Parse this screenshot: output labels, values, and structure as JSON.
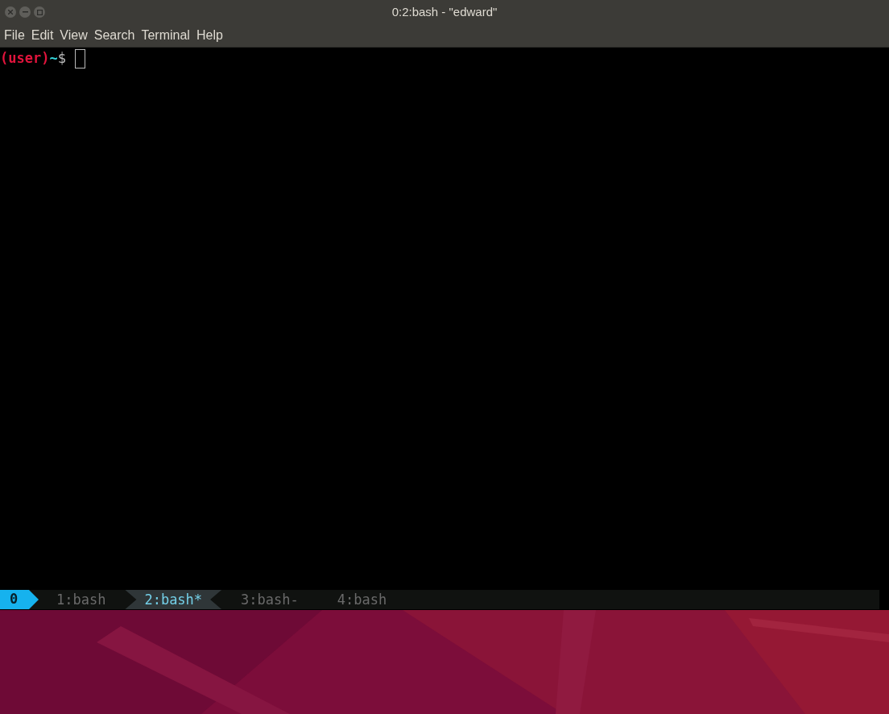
{
  "window": {
    "title": "0:2:bash - \"edward\""
  },
  "menu": [
    "File",
    "Edit",
    "View",
    "Search",
    "Terminal",
    "Help"
  ],
  "terminal": {
    "prompt_user": "(user)",
    "prompt_path": "~",
    "prompt_symbol": "$"
  },
  "tmux": {
    "session": "0",
    "windows": [
      {
        "label": "1:bash",
        "selected": false
      },
      {
        "label": "2:bash*",
        "selected": true
      },
      {
        "label": "3:bash-",
        "selected": false
      },
      {
        "label": "4:bash",
        "selected": false
      }
    ]
  }
}
